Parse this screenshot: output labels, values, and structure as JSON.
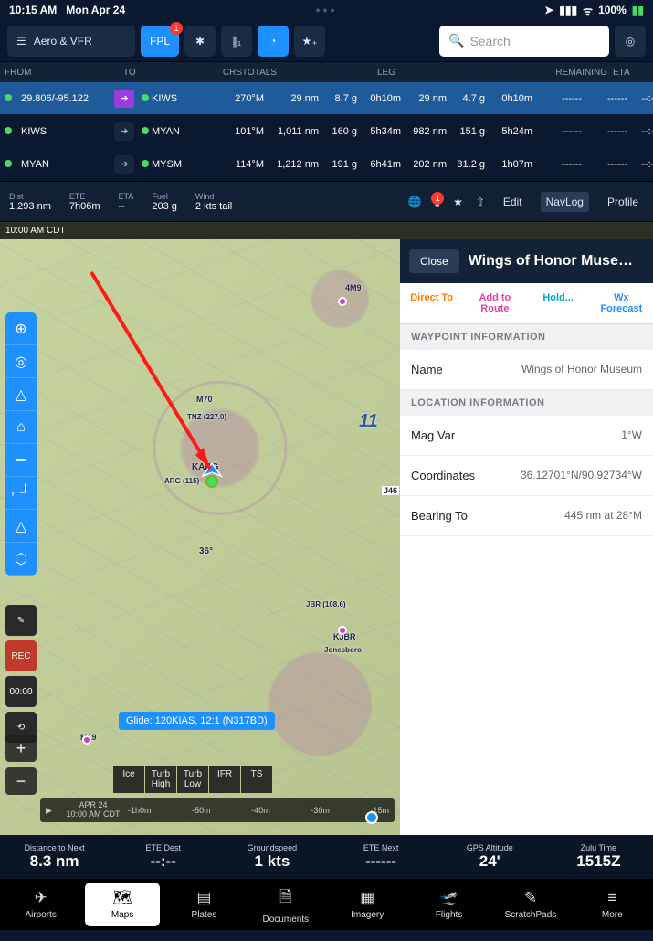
{
  "statusbar": {
    "time": "10:15 AM",
    "date": "Mon Apr 24",
    "battery": "100%",
    "battery_icon": "⚡"
  },
  "toolbar": {
    "layers_label": "Aero & VFR",
    "fpl": "FPL",
    "fpl_badge": "1",
    "search_placeholder": "Search"
  },
  "fpl_header": {
    "from": "FROM",
    "to": "TO",
    "crs": "CRS",
    "totals": "TOTALS",
    "leg": "LEG",
    "remaining": "REMAINING",
    "eta": "ETA"
  },
  "fpl_rows": [
    {
      "sel": true,
      "from": "29.806/-95.122",
      "to": "KIWS",
      "crs": "270°M",
      "dist": "29 nm",
      "fuel": "8.7 g",
      "time": "0h10m",
      "ldist": "29 nm",
      "lfuel": "4.7 g",
      "ltime": "0h10m",
      "r1": "------",
      "r2": "------",
      "eta": "--:--"
    },
    {
      "sel": false,
      "from": "KIWS",
      "to": "MYAN",
      "crs": "101°M",
      "dist": "1,011 nm",
      "fuel": "160 g",
      "time": "5h34m",
      "ldist": "982 nm",
      "lfuel": "151 g",
      "ltime": "5h24m",
      "r1": "------",
      "r2": "------",
      "eta": "--:--"
    },
    {
      "sel": false,
      "from": "MYAN",
      "to": "MYSM",
      "crs": "114°M",
      "dist": "1,212 nm",
      "fuel": "191 g",
      "time": "6h41m",
      "ldist": "202 nm",
      "lfuel": "31.2 g",
      "ltime": "1h07m",
      "r1": "------",
      "r2": "------",
      "eta": "--:--"
    }
  ],
  "summary": {
    "dist_lbl": "Dist",
    "dist": "1,293 nm",
    "ete_lbl": "ETE",
    "ete": "7h06m",
    "eta_lbl": "ETA",
    "eta": "--",
    "fuel_lbl": "Fuel",
    "fuel": "203 g",
    "wind_lbl": "Wind",
    "wind": "2 kts tail",
    "edit": "Edit",
    "navlog": "NavLog",
    "profile": "Profile",
    "send_badge": "1"
  },
  "map_time": "10:00 AM CDT",
  "glide": "Glide: 120KIAS, 12:1 (N317BD)",
  "time_buttons": [
    "Ice",
    "Turb\nHigh",
    "Turb\nLow",
    "IFR",
    "TS"
  ],
  "timebar": {
    "date": "APR 24",
    "time": "10:00 AM CDT",
    "ticks": [
      "-1h0m",
      "-50m",
      "-40m",
      "-30m",
      "-15m"
    ]
  },
  "map_labels": {
    "m19": "M19",
    "m70": "M70",
    "4m9": "4M9",
    "karg": "KARG",
    "arg": "ARG (115)",
    "tnz": "TNZ (227.0)",
    "kjbr": "KJBR",
    "jonesboro": "Jonesboro",
    "jbr": "JBR (108.6)",
    "lat36": "36°",
    "j146": "J46",
    "eleven": "11"
  },
  "panel": {
    "close": "Close",
    "title": "Wings of Honor Muse…",
    "tab_dt": "Direct To",
    "tab_ar": "Add to Route",
    "tab_hd": "Hold...",
    "tab_wx": "Wx Forecast",
    "sect_wp": "WAYPOINT INFORMATION",
    "name_lbl": "Name",
    "name_val": "Wings of Honor Museum",
    "sect_loc": "LOCATION INFORMATION",
    "mag_lbl": "Mag Var",
    "mag_val": "1°W",
    "coord_lbl": "Coordinates",
    "coord_val": "36.12701°N/90.92734°W",
    "brg_lbl": "Bearing To",
    "brg_val": "445 nm at 28°M"
  },
  "metrics": [
    {
      "lbl": "Distance to Next",
      "val": "8.3 nm"
    },
    {
      "lbl": "ETE Dest",
      "val": "--:--"
    },
    {
      "lbl": "Groundspeed",
      "val": "1 kts"
    },
    {
      "lbl": "ETE Next",
      "val": "------"
    },
    {
      "lbl": "GPS Altitude",
      "val": "24'"
    },
    {
      "lbl": "Zulu Time",
      "val": "1515Z"
    }
  ],
  "tabs": [
    {
      "lbl": "Airports",
      "ico": "✈"
    },
    {
      "lbl": "Maps",
      "ico": "🗺"
    },
    {
      "lbl": "Plates",
      "ico": "▤"
    },
    {
      "lbl": "Documents",
      "ico": "🗎"
    },
    {
      "lbl": "Imagery",
      "ico": "▦"
    },
    {
      "lbl": "Flights",
      "ico": "🛫"
    },
    {
      "lbl": "ScratchPads",
      "ico": "✎"
    },
    {
      "lbl": "More",
      "ico": "≡"
    }
  ]
}
